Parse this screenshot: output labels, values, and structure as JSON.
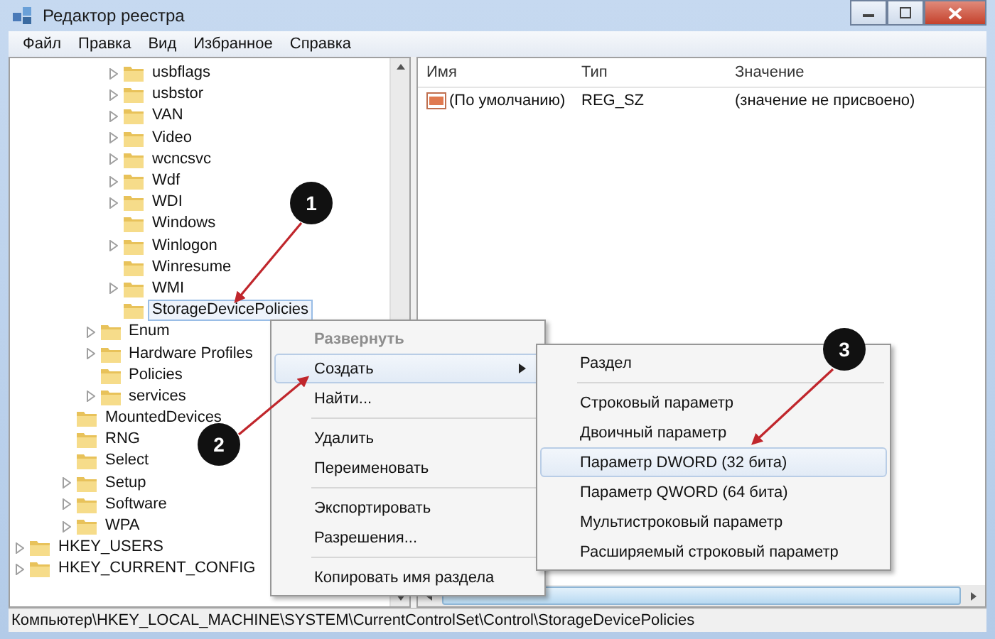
{
  "window": {
    "title": "Редактор реестра"
  },
  "menu": [
    "Файл",
    "Правка",
    "Вид",
    "Избранное",
    "Справка"
  ],
  "tree": [
    {
      "children": [
        {
          "children": [
            {
              "children": [
                {
                  "children": [
                    {
                      "label": "usbflags",
                      "expandable": true,
                      "selected": false
                    },
                    {
                      "label": "usbstor",
                      "expandable": true,
                      "selected": false
                    },
                    {
                      "label": "VAN",
                      "expandable": true,
                      "selected": false
                    },
                    {
                      "label": "Video",
                      "expandable": true,
                      "selected": false
                    },
                    {
                      "label": "wcncsvc",
                      "expandable": true,
                      "selected": false
                    },
                    {
                      "label": "Wdf",
                      "expandable": true,
                      "selected": false
                    },
                    {
                      "label": "WDI",
                      "expandable": true,
                      "selected": false
                    },
                    {
                      "label": "Windows",
                      "expandable": false,
                      "selected": false
                    },
                    {
                      "label": "Winlogon",
                      "expandable": true,
                      "selected": false
                    },
                    {
                      "label": "Winresume",
                      "expandable": false,
                      "selected": false
                    },
                    {
                      "label": "WMI",
                      "expandable": true,
                      "selected": false
                    },
                    {
                      "label": "StorageDevicePolicies",
                      "expandable": false,
                      "selected": true
                    }
                  ]
                },
                {
                  "label": "Enum",
                  "expandable": true,
                  "selected": false
                },
                {
                  "label": "Hardware Profiles",
                  "expandable": true,
                  "selected": false
                },
                {
                  "label": "Policies",
                  "expandable": false,
                  "selected": false
                },
                {
                  "label": "services",
                  "expandable": true,
                  "selected": false
                }
              ]
            },
            {
              "label": "MountedDevices",
              "expandable": false,
              "selected": false
            },
            {
              "label": "RNG",
              "expandable": false,
              "selected": false
            },
            {
              "label": "Select",
              "expandable": false,
              "selected": false
            },
            {
              "label": "Setup",
              "expandable": true,
              "selected": false
            },
            {
              "label": "Software",
              "expandable": true,
              "selected": false
            },
            {
              "label": "WPA",
              "expandable": true,
              "selected": false
            }
          ]
        }
      ]
    },
    {
      "label": "HKEY_USERS",
      "expandable": true,
      "selected": false
    },
    {
      "label": "HKEY_CURRENT_CONFIG",
      "expandable": true,
      "selected": false
    }
  ],
  "values": {
    "columns": [
      "Имя",
      "Тип",
      "Значение"
    ],
    "rows": [
      {
        "name": "(По умолчанию)",
        "type": "REG_SZ",
        "value": "(значение не присвоено)"
      }
    ]
  },
  "context_menu": [
    {
      "kind": "item",
      "label": "Развернуть",
      "disabled": true,
      "selected": false,
      "submenu": false
    },
    {
      "kind": "item",
      "label": "Создать",
      "disabled": false,
      "selected": true,
      "submenu": true
    },
    {
      "kind": "item",
      "label": "Найти...",
      "disabled": false,
      "selected": false,
      "submenu": false
    },
    {
      "kind": "separator"
    },
    {
      "kind": "item",
      "label": "Удалить",
      "disabled": false,
      "selected": false,
      "submenu": false
    },
    {
      "kind": "item",
      "label": "Переименовать",
      "disabled": false,
      "selected": false,
      "submenu": false
    },
    {
      "kind": "separator"
    },
    {
      "kind": "item",
      "label": "Экспортировать",
      "disabled": false,
      "selected": false,
      "submenu": false
    },
    {
      "kind": "item",
      "label": "Разрешения...",
      "disabled": false,
      "selected": false,
      "submenu": false
    },
    {
      "kind": "separator"
    },
    {
      "kind": "item",
      "label": "Копировать имя раздела",
      "disabled": false,
      "selected": false,
      "submenu": false
    }
  ],
  "submenu": [
    {
      "kind": "item",
      "label": "Раздел",
      "selected": false
    },
    {
      "kind": "separator"
    },
    {
      "kind": "item",
      "label": "Строковый параметр",
      "selected": false
    },
    {
      "kind": "item",
      "label": "Двоичный параметр",
      "selected": false
    },
    {
      "kind": "item",
      "label": "Параметр DWORD (32 бита)",
      "selected": true
    },
    {
      "kind": "item",
      "label": "Параметр QWORD (64 бита)",
      "selected": false
    },
    {
      "kind": "item",
      "label": "Мультистроковый параметр",
      "selected": false
    },
    {
      "kind": "item",
      "label": "Расширяемый строковый параметр",
      "selected": false
    }
  ],
  "callouts": [
    "1",
    "2",
    "3"
  ],
  "status_bar": "Компьютер\\HKEY_LOCAL_MACHINE\\SYSTEM\\CurrentControlSet\\Control\\StorageDevicePolicies"
}
